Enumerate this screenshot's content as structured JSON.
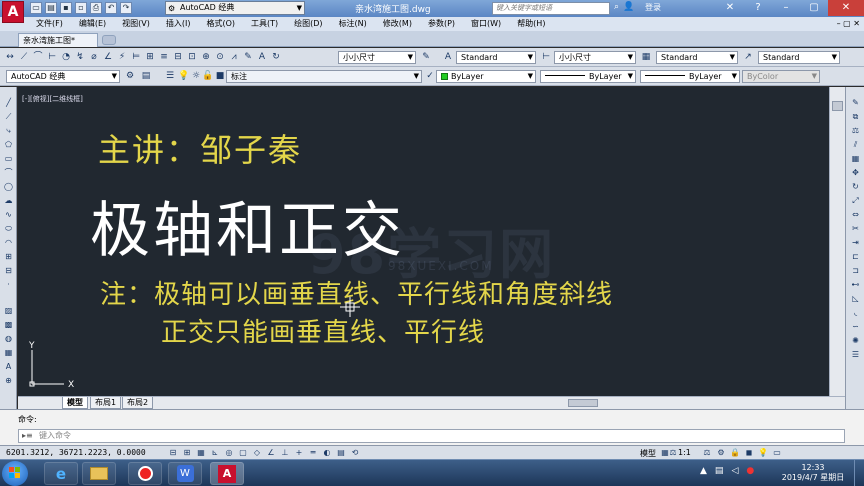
{
  "titlebar": {
    "workspace": "AutoCAD 经典",
    "doc_title": "亲水湾施工图.dwg",
    "search_placeholder": "键入关键字或短语",
    "login": "登录"
  },
  "menu": [
    "文件(F)",
    "编辑(E)",
    "视图(V)",
    "插入(I)",
    "格式(O)",
    "工具(T)",
    "绘图(D)",
    "标注(N)",
    "修改(M)",
    "参数(P)",
    "窗口(W)",
    "帮助(H)"
  ],
  "file_tab": "亲水湾施工图*",
  "toolbar1": {
    "dim_style": "小小尺寸",
    "text_style": "Standard",
    "dim_style2": "小小尺寸",
    "table_style": "Standard",
    "multileader_style": "Standard"
  },
  "toolbar2": {
    "workspace": "AutoCAD 经典",
    "layer": "标注",
    "color": "ByLayer",
    "linetype": "ByLayer",
    "lineweight": "ByLayer",
    "plotstyle": "ByColor"
  },
  "viewport_label": "[-][俯视][二维线框]",
  "canvas_text": {
    "lecturer": "主讲：邹子秦",
    "title": "极轴和正交",
    "note_line1": "注：极轴可以画垂直线、平行线和角度斜线",
    "note_line2": "正交只能画垂直线、平行线"
  },
  "watermark": "98学习网",
  "watermark_sub": "98XUEXI.COM",
  "ucs": {
    "y": "Y",
    "x": "X"
  },
  "layout_tabs": [
    "模型",
    "布局1",
    "布局2"
  ],
  "command": {
    "label": "命令:",
    "placeholder": "键入命令"
  },
  "status": {
    "coords": "6201.3212, 36721.2223, 0.0000",
    "model": "模型",
    "scale": "1:1"
  },
  "clock": {
    "time": "12:33",
    "date": "2019/4/7 星期日"
  },
  "colors": {
    "canvas_bg": "#212830",
    "yellow_text": "#e3d64a",
    "white_text": "#ffffff",
    "title_bar": "#6b93cf"
  }
}
